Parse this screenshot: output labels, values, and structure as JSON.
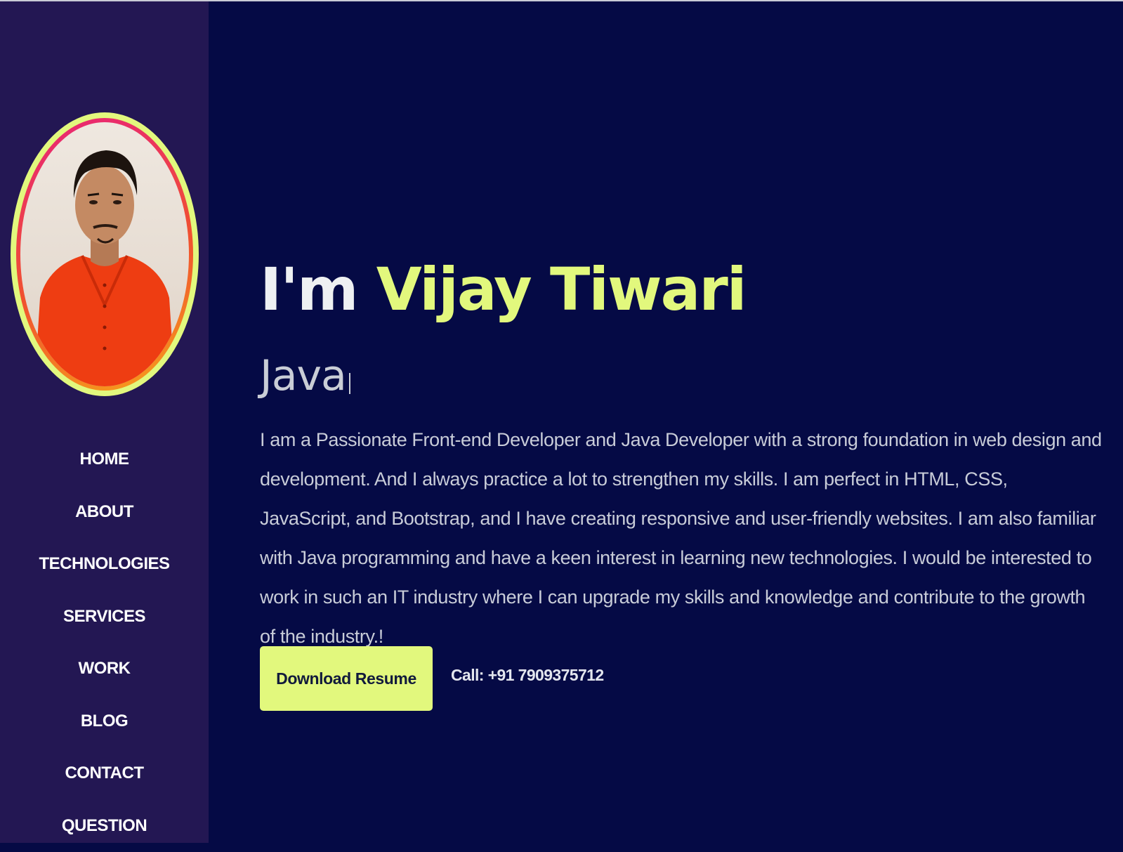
{
  "sidebar": {
    "avatar_alt": "profile photo",
    "nav": [
      {
        "label": "HOME"
      },
      {
        "label": "ABOUT"
      },
      {
        "label": "TECHNOLOGIES"
      },
      {
        "label": "SERVICES"
      },
      {
        "label": "WORK"
      },
      {
        "label": "BLOG"
      },
      {
        "label": "CONTACT"
      },
      {
        "label": "QUESTION"
      }
    ]
  },
  "hero": {
    "greeting": "I'm",
    "name": "Vijay Tiwari",
    "role": "Java",
    "bio": "I am a Passionate Front-end Developer and Java Developer with a strong foundation in web design and development. And I always practice a lot to strengthen my skills. I am perfect in HTML, CSS, JavaScript, and Bootstrap, and I have creating responsive and user-friendly websites. I am also familiar with Java programming and have a keen interest in learning new technologies. I would be interested to work in such an IT industry where I can upgrade my skills and knowledge and contribute to the growth of the industry.!",
    "download_button": "Download Resume",
    "call_text": "Call: +91 7909375712"
  },
  "colors": {
    "background": "#050a45",
    "sidebar": "#231753",
    "accent": "#e2f87d",
    "text": "#eef0f2"
  }
}
